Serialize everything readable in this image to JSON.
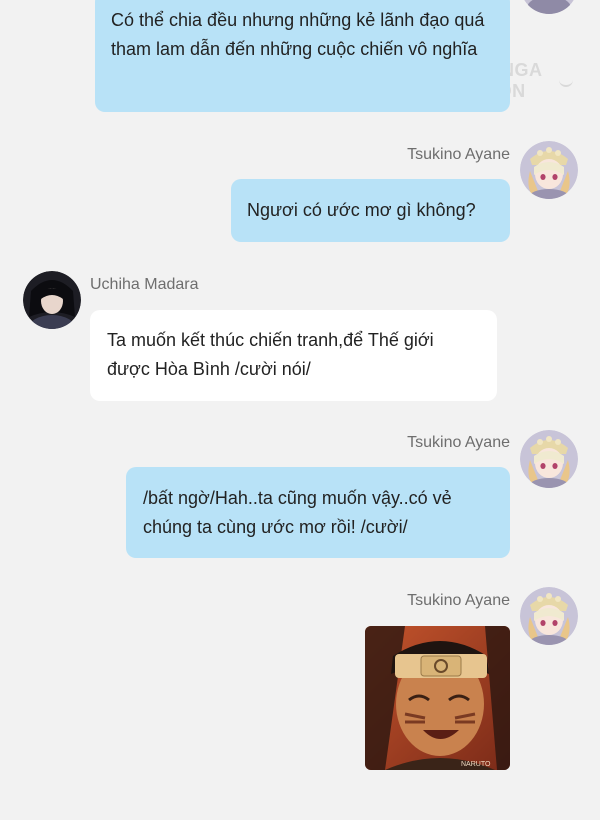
{
  "watermark": "MANGA TOON",
  "messages": [
    {
      "sender": "",
      "side": "right",
      "text": "Có thể chia đều nhưng những kẻ lãnh đạo quá tham lam dẫn đến những cuộc chiến vô nghĩa"
    },
    {
      "sender": "Tsukino Ayane",
      "side": "right",
      "text": "Ngươi có ước mơ gì không?"
    },
    {
      "sender": "Uchiha Madara",
      "side": "left",
      "text": "Ta muốn kết thúc chiến tranh,để Thế giới được Hòa Bình /cười nói/"
    },
    {
      "sender": "Tsukino Ayane",
      "side": "right",
      "text": "/bất ngờ/Hah..ta cũng muốn vậy..có vẻ chúng ta cùng ước mơ rồi! /cười/"
    },
    {
      "sender": "Tsukino Ayane",
      "side": "right",
      "image_caption": "NARUTO"
    }
  ],
  "colors": {
    "my_bubble": "#b8e2f7",
    "other_bubble": "#ffffff",
    "background": "#f2f2f2",
    "name_text": "#6e6e6e"
  },
  "icons": [
    "avatar-tsukino-ayane",
    "avatar-uchiha-madara"
  ]
}
